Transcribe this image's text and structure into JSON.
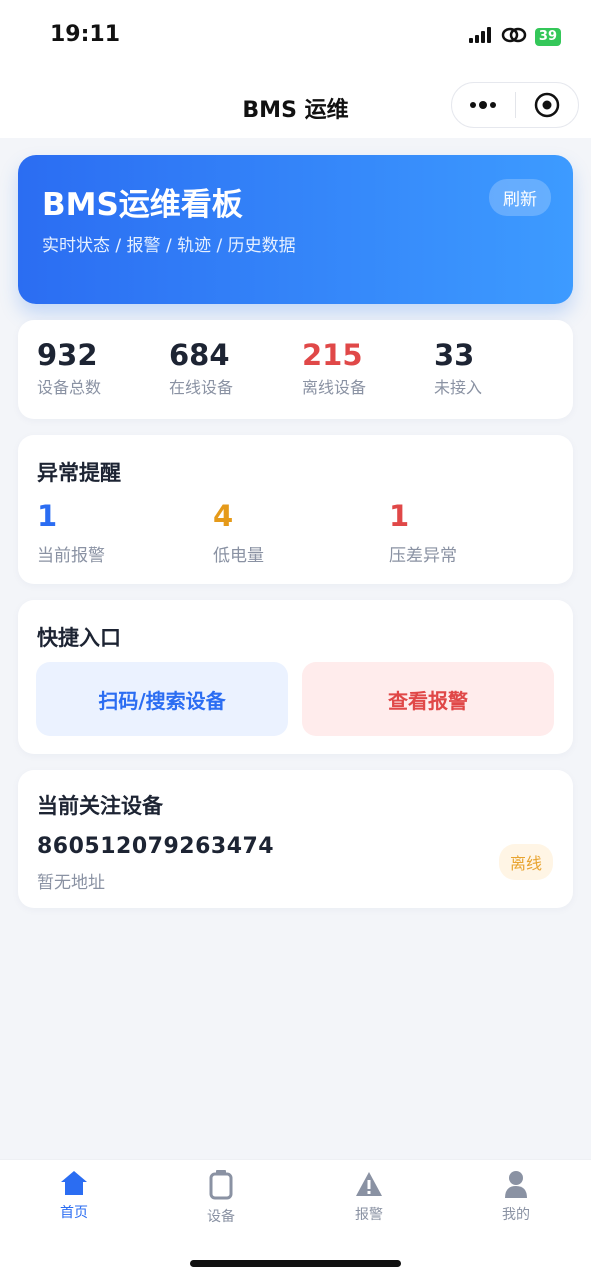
{
  "status_bar": {
    "time": "19:11",
    "battery": "39"
  },
  "navbar": {
    "title": "BMS 运维"
  },
  "hero": {
    "title": "BMS运维看板",
    "subtitle": "实时状态 / 报警 / 轨迹 / 历史数据",
    "refresh_label": "刷新",
    "gradient_start": "#2b6df2",
    "gradient_end": "#3d9bff"
  },
  "stats": [
    {
      "value": "932",
      "label": "设备总数",
      "color": "#1d2433"
    },
    {
      "value": "684",
      "label": "在线设备",
      "color": "#1d2433"
    },
    {
      "value": "215",
      "label": "离线设备",
      "color": "#e04848"
    },
    {
      "value": "33",
      "label": "未接入",
      "color": "#1d2433"
    }
  ],
  "alerts": {
    "title": "异常提醒",
    "items": [
      {
        "value": "1",
        "label": "当前报警",
        "color": "#2b6df2"
      },
      {
        "value": "4",
        "label": "低电量",
        "color": "#e59a1a"
      },
      {
        "value": "1",
        "label": "压差异常",
        "color": "#e04848"
      }
    ]
  },
  "quick": {
    "title": "快捷入口",
    "scan_label": "扫码/搜索设备",
    "alarm_label": "查看报警"
  },
  "focus": {
    "title": "当前关注设备",
    "device_id": "860512079263474",
    "address": "暂无地址",
    "status": "离线"
  },
  "tabbar": {
    "items": [
      {
        "label": "首页",
        "icon": "home-icon",
        "active": true
      },
      {
        "label": "设备",
        "icon": "device-icon",
        "active": false
      },
      {
        "label": "报警",
        "icon": "warning-icon",
        "active": false
      },
      {
        "label": "我的",
        "icon": "user-icon",
        "active": false
      }
    ]
  }
}
